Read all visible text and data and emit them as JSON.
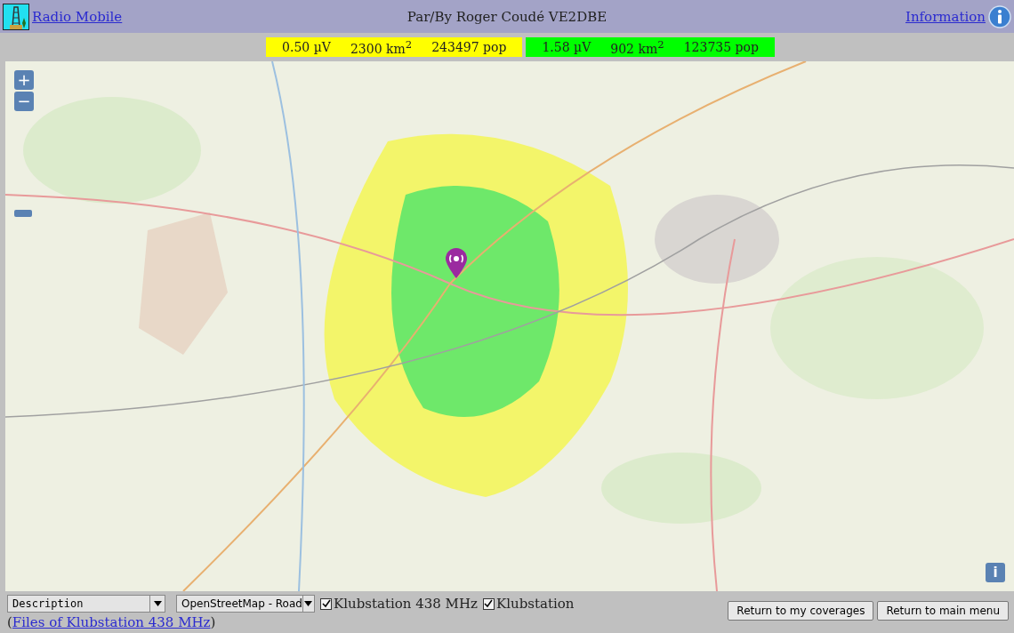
{
  "header": {
    "home_link": "Radio Mobile",
    "author": "Par/By Roger Coudé VE2DBE",
    "info_link": "Information"
  },
  "legend": [
    {
      "color": "#ffff00",
      "voltage": "0.50 µV",
      "area": "2300 km$^{2}$",
      "population": "243497 pop"
    },
    {
      "color": "#00ff00",
      "voltage": "1.58 µV",
      "area": "902 km$^{2}$",
      "population": "123735 pop"
    }
  ],
  "map": {
    "zoom_in": "+",
    "zoom_out": "−",
    "info_button": "i"
  },
  "controls": {
    "view_select": "Description",
    "map_select": "OpenStreetMap - Road",
    "layers": [
      {
        "label": "Klubstation 438 MHz",
        "checked": true
      },
      {
        "label": "Klubstation",
        "checked": true
      }
    ]
  },
  "files_link": {
    "open": "(",
    "text": "Files of Klubstation 438 MHz",
    "close": ")"
  },
  "buttons": [
    "Return to my coverages",
    "Return to main menu"
  ]
}
